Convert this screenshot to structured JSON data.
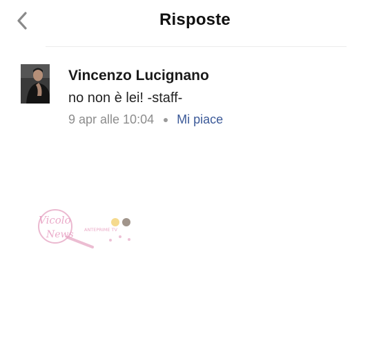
{
  "header": {
    "title": "Risposte",
    "back_icon": "chevron-left-icon"
  },
  "comment": {
    "author": "Vincenzo Lucignano",
    "text": "no non è lei! -staff-",
    "timestamp": "9 apr alle 10:04",
    "like_label": "Mi piace"
  },
  "watermark": {
    "logo_text": "Vicolo delle News",
    "tagline": "ANTEPRIME TV"
  },
  "colors": {
    "accent": "#3b5998",
    "text": "#222222",
    "muted": "#8c8c8c",
    "watermark_pink": "#e6a7c4"
  }
}
